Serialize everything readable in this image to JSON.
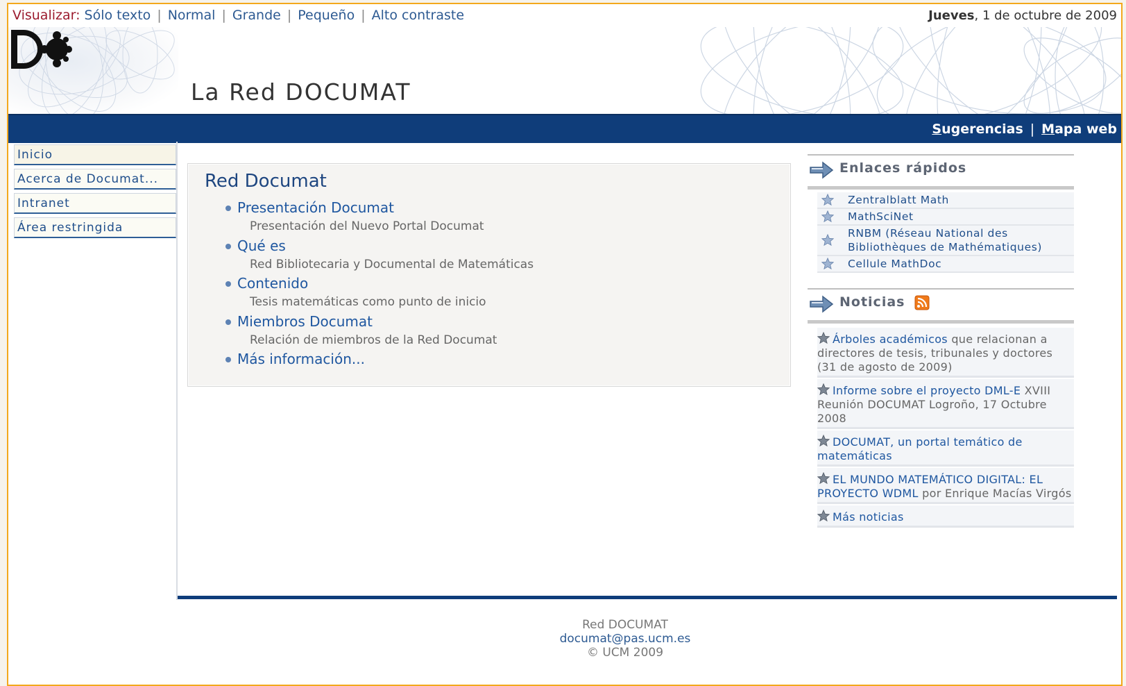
{
  "topbar": {
    "view_label": "Visualizar:",
    "links": [
      "Sólo texto",
      "Normal",
      "Grande",
      "Pequeño",
      "Alto contraste"
    ],
    "date_day": "Jueves",
    "date_rest": ", 1 de octubre de 2009"
  },
  "header": {
    "site_title": "La Red DOCUMAT",
    "logo_text": "Do"
  },
  "bluebar": {
    "suggestions_first": "S",
    "suggestions_rest": "ugerencias",
    "separator": "|",
    "sitemap_first": "M",
    "sitemap_rest": "apa web"
  },
  "leftnav": {
    "items": [
      "Inicio",
      "Acerca de Documat...",
      "Intranet",
      "Área restringida"
    ]
  },
  "panel": {
    "title": "Red Documat",
    "items": [
      {
        "title": "Presentación Documat",
        "desc": "Presentación del Nuevo Portal Documat"
      },
      {
        "title": "Qué es",
        "desc": "Red Bibliotecaria y Documental de Matemáticas"
      },
      {
        "title": "Contenido",
        "desc": "Tesis matemáticas como punto de inicio"
      },
      {
        "title": "Miembros Documat",
        "desc": "Relación de miembros de la Red Documat"
      },
      {
        "title": "Más información...",
        "desc": ""
      }
    ]
  },
  "quicklinks": {
    "title": "Enlaces rápidos",
    "items": [
      "Zentralblatt Math",
      "MathSciNet",
      "RNBM (Réseau National des Bibliothèques de Mathématiques)",
      "Cellule MathDoc"
    ]
  },
  "news": {
    "title": "Noticias",
    "items": [
      {
        "link": "Árboles académicos",
        "text": " que relacionan a directores de tesis, tribunales y doctores (31 de agosto de 2009)"
      },
      {
        "link": "Informe sobre el proyecto DML-E",
        "text": " XVIII Reunión DOCUMAT Logroño, 17 Octubre 2008"
      },
      {
        "link": "DOCUMAT, un portal temático de matemáticas",
        "text": ""
      },
      {
        "link": "EL MUNDO MATEMÁTICO DIGITAL: EL PROYECTO WDML",
        "text": " por Enrique Macías Virgós"
      },
      {
        "link": "Más noticias",
        "text": ""
      }
    ]
  },
  "footer": {
    "line1": "Red DOCUMAT",
    "email": "documat@pas.ucm.es",
    "line3": "© UCM 2009"
  },
  "colors": {
    "navy": "#0f3d7a",
    "link": "#1f57a0",
    "frame": "#f3a81c",
    "view_label": "#9b1b2e"
  }
}
